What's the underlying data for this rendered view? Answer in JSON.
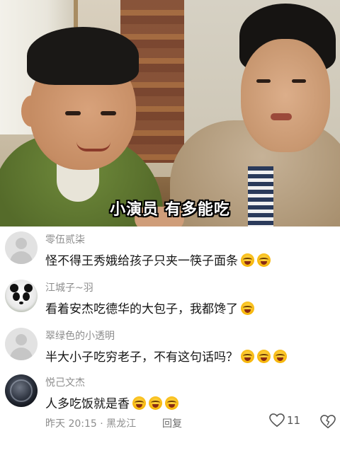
{
  "video": {
    "caption": "小演员 有多能吃"
  },
  "comments": [
    {
      "username": "零伍贰柒",
      "avatar": "default-avatar",
      "text": "怪不得王秀娥给孩子只夹一筷子面条",
      "emoji_count": 2
    },
    {
      "username": "江城子~羽",
      "avatar": "panda-avatar",
      "text": "看着安杰吃德华的大包子，我都馋了",
      "emoji_count": 1
    },
    {
      "username": "翠绿色的小透明",
      "avatar": "default-avatar",
      "text": "半大小子吃穷老子，不有这句话吗？",
      "emoji_count": 3
    },
    {
      "username": "悦己文杰",
      "avatar": "moon-avatar",
      "text": "人多吃饭就是香",
      "emoji_count": 3
    }
  ],
  "last_comment_meta": {
    "time_location": "昨天 20:15 · 黑龙江",
    "reply_label": "回复",
    "like_count": "11"
  },
  "colors": {
    "meta_gray": "#8d8d8d",
    "text": "#161616",
    "emoji": "#f5b100"
  }
}
